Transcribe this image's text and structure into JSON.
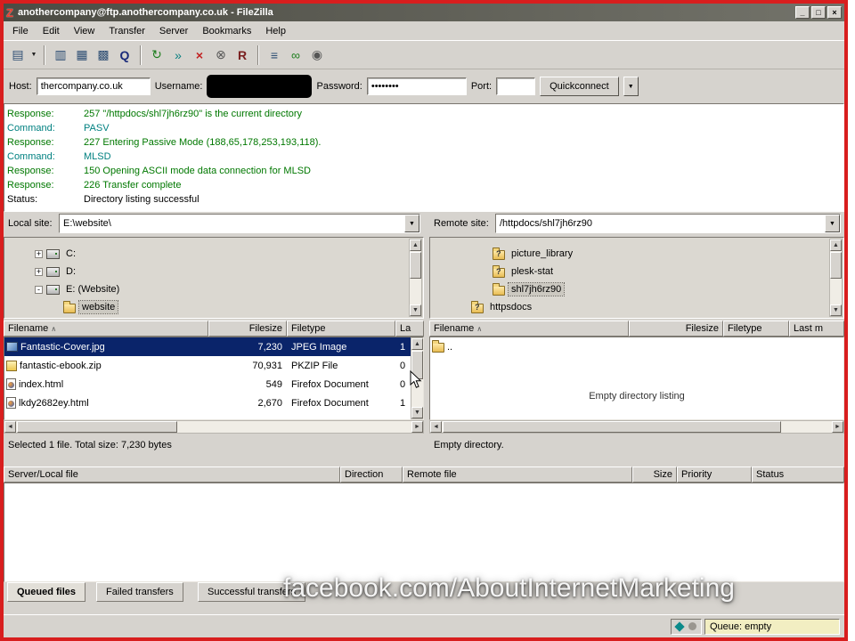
{
  "window": {
    "title": "anothercompany@ftp.anothercompany.co.uk - FileZilla"
  },
  "icons": {
    "filezilla_logo": "Z",
    "minimize": "_",
    "maximize": "□",
    "close": "×",
    "caret_down": "▼",
    "arrow_up": "▲",
    "arrow_down": "▼",
    "arrow_left": "◄",
    "arrow_right": "►",
    "sort_ascending": "∧",
    "question_mark": "?"
  },
  "menu": {
    "items": [
      "File",
      "Edit",
      "View",
      "Transfer",
      "Server",
      "Bookmarks",
      "Help"
    ]
  },
  "toolbar": {
    "buttons": [
      {
        "name": "site-manager",
        "glyph": "▤"
      },
      {
        "name": "message-log-toggle",
        "glyph": "▥"
      },
      {
        "name": "local-tree-toggle",
        "glyph": "▦"
      },
      {
        "name": "remote-tree-toggle",
        "glyph": "▩"
      },
      {
        "name": "queue-toggle",
        "glyph": "Q"
      },
      {
        "name": "refresh",
        "glyph": "↻"
      },
      {
        "name": "process-queue",
        "glyph": "»"
      },
      {
        "name": "cancel",
        "glyph": "×"
      },
      {
        "name": "disconnect",
        "glyph": "⊗"
      },
      {
        "name": "reconnect",
        "glyph": "R"
      },
      {
        "name": "directory-comparison",
        "glyph": "≡"
      },
      {
        "name": "synchronized-browsing",
        "glyph": "∞"
      },
      {
        "name": "find-files",
        "glyph": "◉"
      }
    ]
  },
  "quickconnect": {
    "host_label": "Host:",
    "host_value": "thercompany.co.uk",
    "username_label": "Username:",
    "password_label": "Password:",
    "password_value": "••••••••",
    "port_label": "Port:",
    "port_value": "",
    "button_label": "Quickconnect"
  },
  "log": {
    "colors": {
      "response": "#007800",
      "command": "#008080",
      "status": "#000000"
    },
    "lines": [
      {
        "label": "Response:",
        "text": "257 \"/httpdocs/shl7jh6rz90\" is the current directory",
        "kind": "response"
      },
      {
        "label": "Command:",
        "text": "PASV",
        "kind": "command"
      },
      {
        "label": "Response:",
        "text": "227 Entering Passive Mode (188,65,178,253,193,118).",
        "kind": "response"
      },
      {
        "label": "Command:",
        "text": "MLSD",
        "kind": "command"
      },
      {
        "label": "Response:",
        "text": "150 Opening ASCII mode data connection for MLSD",
        "kind": "response"
      },
      {
        "label": "Response:",
        "text": "226 Transfer complete",
        "kind": "response"
      },
      {
        "label": "Status:",
        "text": "Directory listing successful",
        "kind": "status"
      }
    ]
  },
  "local_pane": {
    "site_label": "Local site:",
    "path": "E:\\website\\",
    "tree": [
      {
        "toggle": "+",
        "label": "C:"
      },
      {
        "toggle": "+",
        "label": "D:"
      },
      {
        "toggle": "-",
        "label": "E: (Website)"
      },
      {
        "label": "website"
      }
    ],
    "columns": {
      "name": "Filename",
      "size": "Filesize",
      "type": "Filetype",
      "last": "La"
    },
    "files": [
      {
        "name": "Fantastic-Cover.jpg",
        "size": "7,230",
        "type": "JPEG Image",
        "last": "1"
      },
      {
        "name": "fantastic-ebook.zip",
        "size": "70,931",
        "type": "PKZIP File",
        "last": "0"
      },
      {
        "name": "index.html",
        "size": "549",
        "type": "Firefox Document",
        "last": "0"
      },
      {
        "name": "lkdy2682ey.html",
        "size": "2,670",
        "type": "Firefox Document",
        "last": "1"
      }
    ],
    "status": "Selected 1 file. Total size: 7,230 bytes"
  },
  "remote_pane": {
    "site_label": "Remote site:",
    "path": "/httpdocs/shl7jh6rz90",
    "tree": [
      {
        "label": "picture_library"
      },
      {
        "label": "plesk-stat"
      },
      {
        "label": "shl7jh6rz90"
      },
      {
        "label": "httpsdocs"
      }
    ],
    "columns": {
      "name": "Filename",
      "size": "Filesize",
      "type": "Filetype",
      "last": "Last m"
    },
    "updir": "..",
    "empty_message": "Empty directory listing",
    "status": "Empty directory."
  },
  "queue_panel": {
    "columns": [
      "Server/Local file",
      "Direction",
      "Remote file",
      "Size",
      "Priority",
      "Status"
    ],
    "tabs": [
      "Queued files",
      "Failed transfers",
      "Successful transfers"
    ]
  },
  "statusbar": {
    "queue_status": "Queue: empty"
  },
  "watermark": "facebook.com/AboutInternetMarketing"
}
